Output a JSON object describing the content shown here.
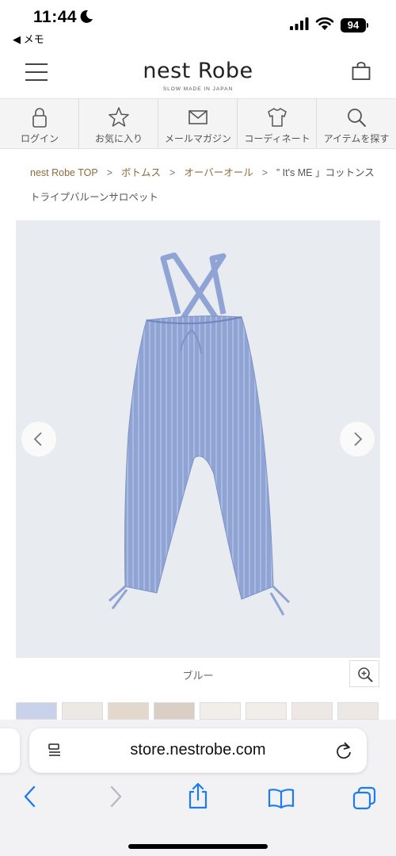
{
  "status_bar": {
    "time": "11:44",
    "back_app": "◀ メモ",
    "battery": "94"
  },
  "header": {
    "logo": "nest Robe",
    "tagline": "SLOW MADE IN JAPAN"
  },
  "icon_nav": [
    {
      "label": "ログイン",
      "icon": "lock-icon"
    },
    {
      "label": "お気に入り",
      "icon": "star-icon"
    },
    {
      "label": "メールマガジン",
      "icon": "mail-icon"
    },
    {
      "label": "コーディネート",
      "icon": "shirt-icon"
    },
    {
      "label": "アイテムを探す",
      "icon": "search-icon"
    }
  ],
  "breadcrumb": {
    "items": [
      "nest Robe TOP",
      "ボトムス",
      "オーバーオール"
    ],
    "separator": ">",
    "current": "” It's ME 」コットンストライプバルーンサロペット"
  },
  "product": {
    "color_caption": "ブルー"
  },
  "browser": {
    "url": "store.nestrobe.com"
  },
  "colors": {
    "accent": "#8c6b3b",
    "link_blue": "#1a7cf0",
    "garment": "#8fa3d4"
  }
}
